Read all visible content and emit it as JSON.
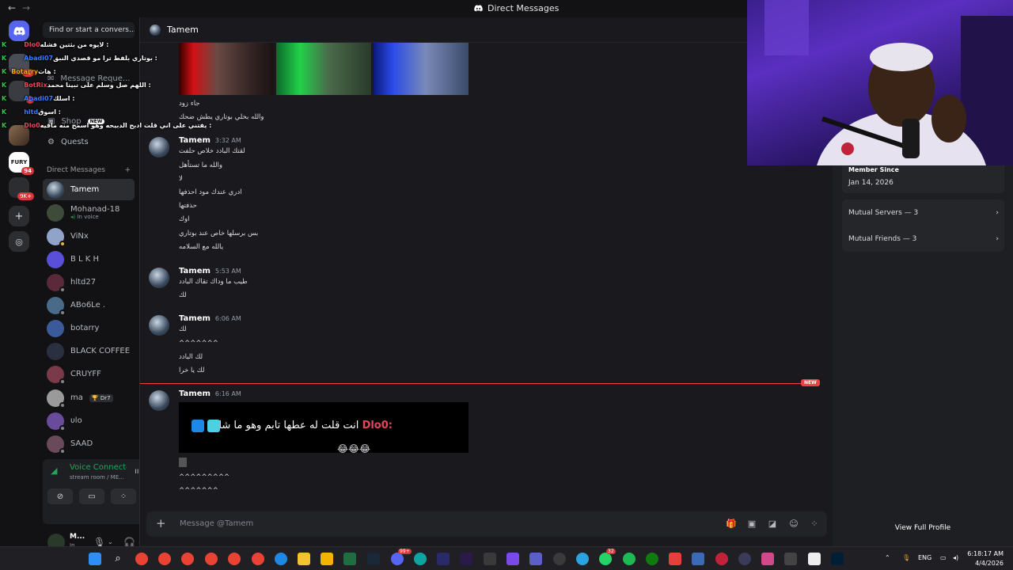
{
  "window": {
    "back": "←",
    "forward": "→",
    "title": "Direct Messages"
  },
  "rail": {
    "badges": {
      "server2": "42",
      "server3": "1",
      "fury": "94",
      "stack": "9K+"
    }
  },
  "dmlist": {
    "search_placeholder": "Find or start a convers...",
    "nav": {
      "message_requests": "Message Reque...",
      "shop": "Shop",
      "shop_badge": "NEW",
      "quests": "Quests"
    },
    "header": "Direct Messages",
    "add": "+",
    "items": [
      {
        "name": "Tamem",
        "sub": ""
      },
      {
        "name": "Mohanad-18",
        "sub": "In voice"
      },
      {
        "name": "ViNx",
        "sub": ""
      },
      {
        "name": "B L K H",
        "sub": ""
      },
      {
        "name": "hltd27",
        "sub": ""
      },
      {
        "name": "ABo6Le .",
        "sub": ""
      },
      {
        "name": "botarry",
        "sub": ""
      },
      {
        "name": "BLACK COFFEE",
        "sub": ""
      },
      {
        "name": "CRUYFF",
        "sub": ""
      },
      {
        "name": "ma",
        "sub": "",
        "tag": "Dr7"
      },
      {
        "name": "υlo",
        "sub": ""
      },
      {
        "name": "SAAD",
        "sub": ""
      }
    ]
  },
  "voice": {
    "title": "Voice Connected",
    "sub": "stream room / ME..."
  },
  "user": {
    "name": "M...",
    "status": "In"
  },
  "chat": {
    "header": "Tamem",
    "messages": [
      {
        "author": "",
        "time": "",
        "lines": [
          "جاء زود",
          "والله بخلي بوتاري يطش ضحك"
        ]
      },
      {
        "author": "Tamem",
        "time": "3:32 AM",
        "lines": [
          "لقتك البادد خلاص حلفت",
          "والله ما تستأهل",
          "لا",
          "ادري عندك مود احذفها",
          "حذفتها",
          "اوك",
          "بس برسلها خاص عند بوتاري",
          "يالله مع السلامه"
        ]
      },
      {
        "author": "Tamem",
        "time": "5:53 AM",
        "lines": [
          "طيب ما وداك تقاك البادد",
          "لك"
        ]
      },
      {
        "author": "Tamem",
        "time": "6:06 AM",
        "lines": [
          "لك",
          "^^^^^^^",
          "لك البادد",
          "لك يا خرا"
        ]
      },
      {
        "author": "Tamem",
        "time": "6:16 AM",
        "lines": [
          "^^^^^^^^^",
          "^^^^^^^"
        ]
      }
    ],
    "embed": {
      "name": "Dlo0:",
      "text": "انت قلت له عطها تابم وهو ما شاله"
    },
    "new_label": "NEW",
    "composer_placeholder": "Message @Tamem"
  },
  "profile": {
    "member_since_label": "Member Since",
    "member_since": "Jan 14, 2026",
    "mutual_servers": "Mutual Servers — 3",
    "mutual_friends": "Mutual Friends — 3",
    "view_full": "View Full Profile"
  },
  "overlay": [
    {
      "user": "Dlo0",
      "text": "لايوه من بثتين فشله :",
      "color": "#e8455b"
    },
    {
      "user": "Abadi07",
      "text": "بوتاري بلفط ترا مو قصدي النبق :",
      "color": "#3d7bff"
    },
    {
      "user": "Botarry",
      "text": "هات :",
      "color": "#f5a623"
    },
    {
      "user": "BotRix",
      "text": "اللهم صل وسلم على نبينا محمد :",
      "color": "#e8455b"
    },
    {
      "user": "Abadi07",
      "text": "اسلك :",
      "color": "#3d7bff"
    },
    {
      "user": "hltd",
      "text": "اسوق :",
      "color": "#3d7bff"
    },
    {
      "user": "Dlo0",
      "text": "يفتني على اني قلت ادبح الدبيحه وهو اسمح منه ماقيه :",
      "color": "#e8455b"
    }
  ],
  "taskbar": {
    "badges": {
      "discord": "99+",
      "whatsapp": "32"
    },
    "lang": "ENG",
    "time": "6:18:17 AM",
    "date": "4/4/2026"
  },
  "colors": {
    "accent": "#5865f2",
    "online": "#23a55a",
    "danger": "#f23f43"
  }
}
